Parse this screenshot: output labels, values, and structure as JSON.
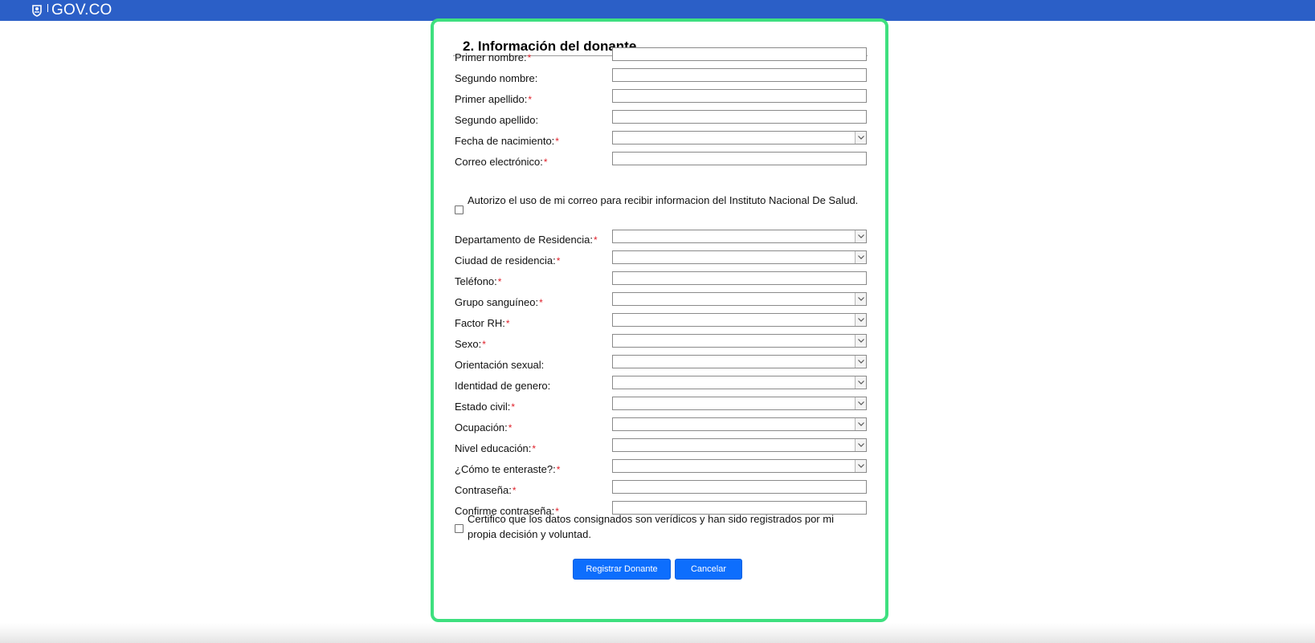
{
  "header": {
    "brand": "GOV.CO",
    "logo_icon": "colombia-coat-of-arms-icon",
    "bar_color": "#2b5fc7"
  },
  "form": {
    "section_title": "2. Información del donante",
    "required_marker": "*",
    "fields": [
      {
        "label": "Primer nombre:",
        "required": true,
        "type": "text"
      },
      {
        "label": "Segundo nombre:",
        "required": false,
        "type": "text"
      },
      {
        "label": "Primer apellido:",
        "required": true,
        "type": "text"
      },
      {
        "label": "Segundo apellido:",
        "required": false,
        "type": "text"
      },
      {
        "label": "Fecha de nacimiento:",
        "required": true,
        "type": "select"
      },
      {
        "label": "Correo electrónico:",
        "required": true,
        "type": "text"
      },
      {
        "label": "Departamento de Residencia:",
        "required": true,
        "type": "select"
      },
      {
        "label": "Ciudad de residencia:",
        "required": true,
        "type": "select"
      },
      {
        "label": "Teléfono:",
        "required": true,
        "type": "text"
      },
      {
        "label": "Grupo sanguíneo:",
        "required": true,
        "type": "select"
      },
      {
        "label": "Factor RH:",
        "required": true,
        "type": "select"
      },
      {
        "label": "Sexo:",
        "required": true,
        "type": "select"
      },
      {
        "label": "Orientación sexual:",
        "required": false,
        "type": "select"
      },
      {
        "label": "Identidad de genero:",
        "required": false,
        "type": "select"
      },
      {
        "label": "Estado civil:",
        "required": true,
        "type": "select"
      },
      {
        "label": "Ocupación:",
        "required": true,
        "type": "select"
      },
      {
        "label": "Nivel educación:",
        "required": true,
        "type": "select"
      },
      {
        "label": "¿Cómo te enteraste?:",
        "required": true,
        "type": "select"
      },
      {
        "label": "Contraseña:",
        "required": true,
        "type": "password"
      },
      {
        "label": "Confirme contraseña:",
        "required": true,
        "type": "password"
      }
    ],
    "email_consent": "Autorizo el uso de mi correo para recibir informacion del Instituto Nacional De Salud.",
    "certify": "Certifico que los datos consignados son verídicos y han sido registrados por mi propia decisión y voluntad.",
    "buttons": {
      "register": "Registrar Donante",
      "cancel": "Cancelar"
    }
  },
  "colors": {
    "card_border": "#3ee07f",
    "button": "#0d6efd",
    "required": "#e0202a"
  }
}
